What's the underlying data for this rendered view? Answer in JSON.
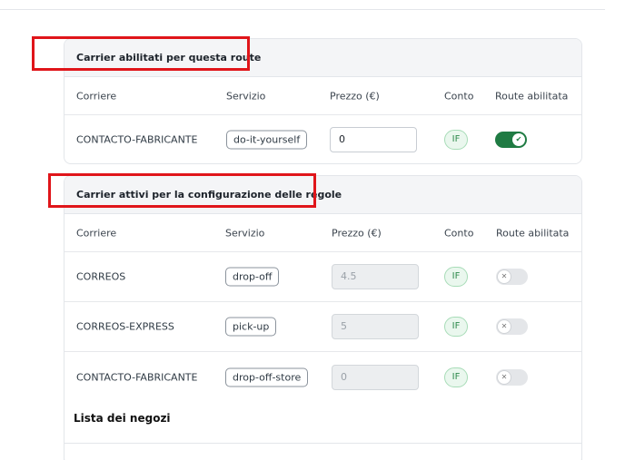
{
  "card1": {
    "title": "Carrier abilitati per questa route",
    "headers": {
      "carrier": "Corriere",
      "service": "Servizio",
      "price": "Prezzo (€)",
      "account": "Conto",
      "enabled": "Route abilitata"
    },
    "rows": [
      {
        "carrier": "CONTACTO-FABRICANTE",
        "service": "do-it-yourself",
        "price": "0",
        "account": "IF",
        "enabled": true
      }
    ]
  },
  "card2": {
    "title": "Carrier attivi per la configurazione delle regole",
    "headers": {
      "carrier": "Corriere",
      "service": "Servizio",
      "price": "Prezzo (€)",
      "account": "Conto",
      "enabled": "Route abilitata"
    },
    "rows": [
      {
        "carrier": "CORREOS",
        "service": "drop-off",
        "price": "4.5",
        "account": "IF",
        "enabled": false
      },
      {
        "carrier": "CORREOS-EXPRESS",
        "service": "pick-up",
        "price": "5",
        "account": "IF",
        "enabled": false
      },
      {
        "carrier": "CONTACTO-FABRICANTE",
        "service": "drop-off-store",
        "price": "0",
        "account": "IF",
        "enabled": false
      }
    ]
  },
  "stores": {
    "title": "Lista dei negozi"
  },
  "icons": {
    "toggle_on": "check-icon",
    "toggle_off": "x-icon"
  },
  "colors": {
    "highlight": "#e0151a",
    "toggle_on": "#1f7b43",
    "badge_text": "#2f8a4d"
  }
}
